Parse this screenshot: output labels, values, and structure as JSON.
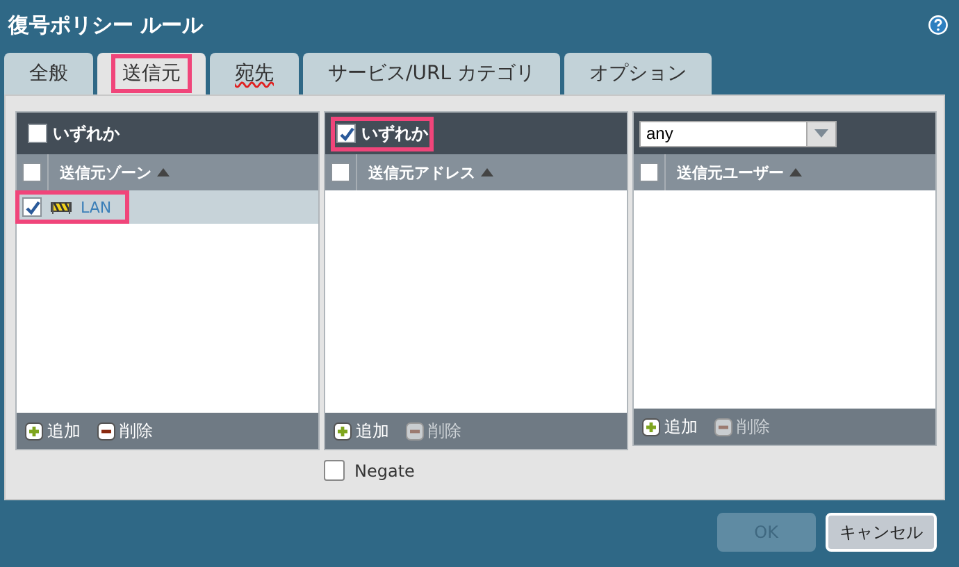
{
  "dialog": {
    "title": "復号ポリシー ルール"
  },
  "tabs": [
    {
      "label": "全般",
      "selected": false,
      "highlighted": false,
      "flagged": false
    },
    {
      "label": "送信元",
      "selected": true,
      "highlighted": true,
      "flagged": false
    },
    {
      "label": "宛先",
      "selected": false,
      "highlighted": false,
      "flagged": true
    },
    {
      "label": "サービス/URL カテゴリ",
      "selected": false,
      "highlighted": false,
      "flagged": false
    },
    {
      "label": "オプション",
      "selected": false,
      "highlighted": false,
      "flagged": false
    }
  ],
  "panels": [
    {
      "kind": "any",
      "any": {
        "label": "いずれか",
        "checked": false,
        "highlighted": false
      },
      "column": {
        "label": "送信元ゾーン",
        "checked": false
      },
      "rows": [
        {
          "label": "LAN",
          "checked": true,
          "highlighted": true
        }
      ],
      "actions": [
        {
          "kind": "add",
          "label": "追加",
          "disabled": false
        },
        {
          "kind": "delete",
          "label": "削除",
          "disabled": false
        }
      ]
    },
    {
      "kind": "any",
      "any": {
        "label": "いずれか",
        "checked": true,
        "highlighted": true
      },
      "column": {
        "label": "送信元アドレス",
        "checked": false
      },
      "actions": [
        {
          "kind": "add",
          "label": "追加",
          "disabled": false
        },
        {
          "kind": "delete",
          "label": "削除",
          "disabled": true
        }
      ]
    },
    {
      "kind": "select",
      "select": {
        "value": "any"
      },
      "column": {
        "label": "送信元ユーザー",
        "checked": false
      },
      "actions": [
        {
          "kind": "add",
          "label": "追加",
          "disabled": false
        },
        {
          "kind": "delete",
          "label": "削除",
          "disabled": true
        }
      ]
    }
  ],
  "negate": {
    "label": "Negate",
    "checked": false
  },
  "buttons": [
    {
      "label": "OK",
      "disabled": true
    },
    {
      "label": "キャンセル",
      "disabled": false
    }
  ]
}
